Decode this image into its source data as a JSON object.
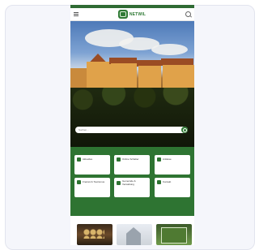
{
  "header": {
    "logo_text": "NETWIL"
  },
  "search": {
    "placeholder": "Suchen..."
  },
  "tiles": [
    {
      "title": "Aktuelles",
      "desc": ""
    },
    {
      "title": "Online Schalter",
      "desc": ""
    },
    {
      "title": "Anlässe",
      "desc": ""
    },
    {
      "title": "Freizeit & Tourismus",
      "desc": ""
    },
    {
      "title": "Gemeinde & Verwaltung",
      "desc": ""
    },
    {
      "title": "Kontakt",
      "desc": ""
    }
  ],
  "colors": {
    "brand_green": "#2e7432",
    "card_background": "#f5f6fb"
  }
}
